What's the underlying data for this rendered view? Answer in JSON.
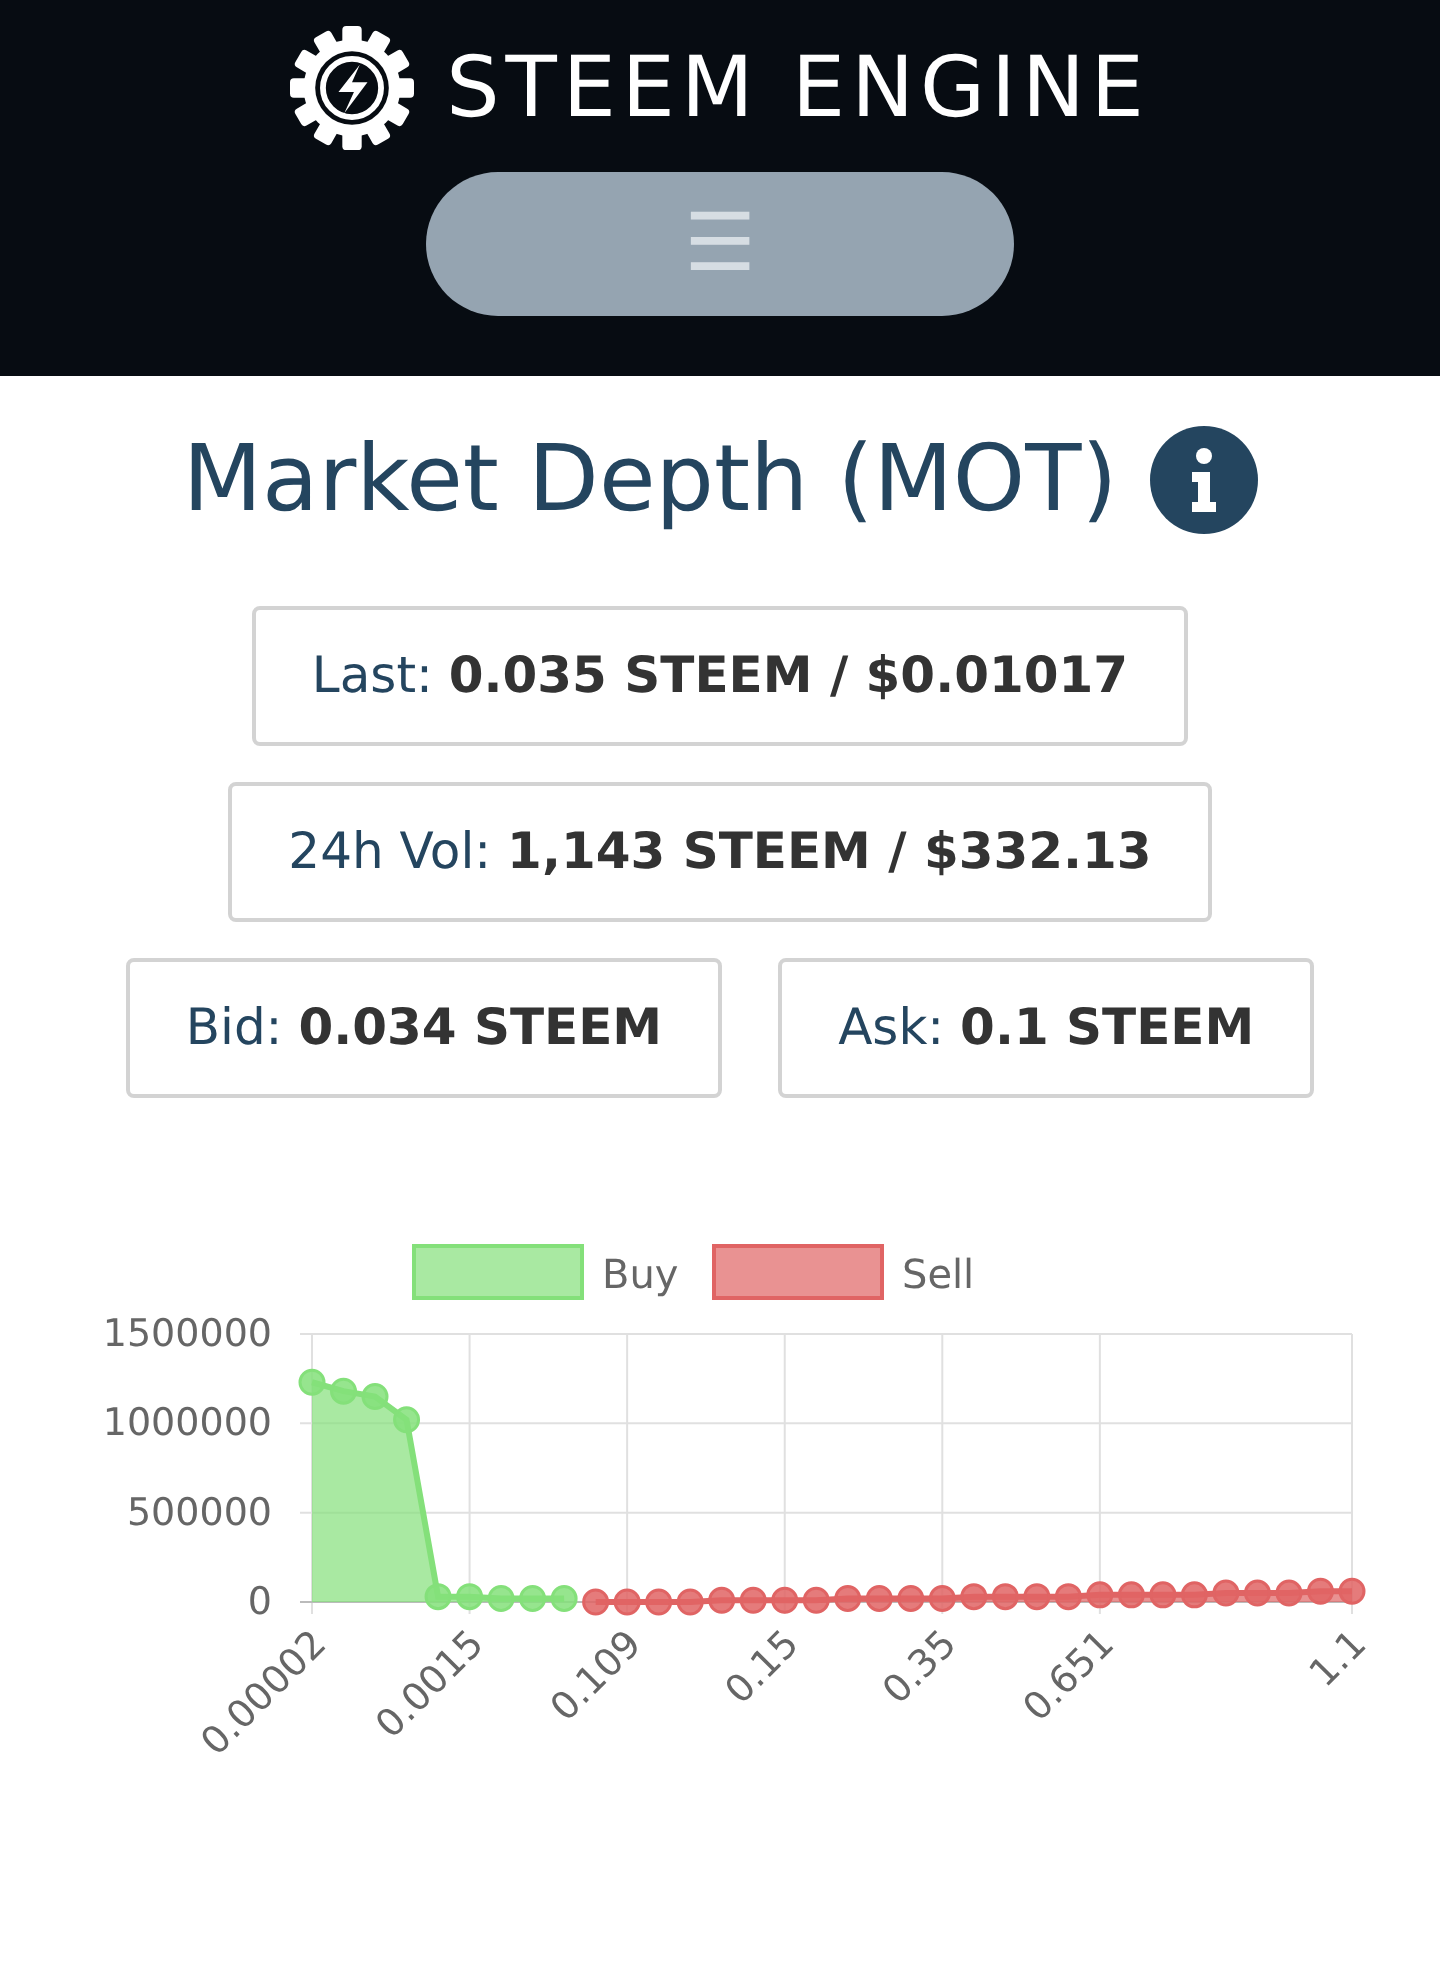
{
  "header": {
    "logo_text": "STEEM ENGINE",
    "menu_button": {
      "label": "☰"
    }
  },
  "title": "Market Depth (MOT)",
  "stats": [
    {
      "label": "Last:",
      "value": "0.035 STEEM / $0.01017"
    },
    {
      "label": "24h Vol:",
      "value": "1,143 STEEM / $332.13"
    },
    {
      "label": "Bid:",
      "value": "0.034 STEEM"
    },
    {
      "label": "Ask:",
      "value": "0.1 STEEM"
    }
  ],
  "chart_data": {
    "type": "area",
    "categories": [
      "0.00002",
      null,
      null,
      null,
      null,
      "0.0015",
      null,
      null,
      null,
      null,
      "0.109",
      null,
      null,
      null,
      null,
      "0.15",
      null,
      null,
      null,
      null,
      "0.35",
      null,
      null,
      null,
      null,
      "0.651",
      null,
      null,
      null,
      null,
      null,
      null,
      null,
      "1.1"
    ],
    "legend": true,
    "yticks": [
      0,
      500000,
      1000000,
      1500000
    ],
    "ylim": [
      0,
      1500000
    ],
    "series": [
      {
        "name": "Buy",
        "color": "#84e07a",
        "values": [
          1230000,
          1180000,
          1150000,
          1020000,
          30000,
          30000,
          20000,
          20000,
          20000,
          null,
          null,
          null,
          null,
          null,
          null,
          null,
          null,
          null,
          null,
          null,
          null,
          null,
          null,
          null,
          null,
          null,
          null,
          null,
          null,
          null,
          null,
          null,
          null,
          null
        ]
      },
      {
        "name": "Sell",
        "color": "#e06464",
        "values": [
          null,
          null,
          null,
          null,
          null,
          null,
          null,
          null,
          null,
          0,
          0,
          0,
          0,
          10000,
          10000,
          10000,
          10000,
          20000,
          20000,
          20000,
          20000,
          30000,
          30000,
          30000,
          30000,
          40000,
          40000,
          40000,
          40000,
          50000,
          50000,
          50000,
          60000,
          60000
        ]
      }
    ]
  }
}
